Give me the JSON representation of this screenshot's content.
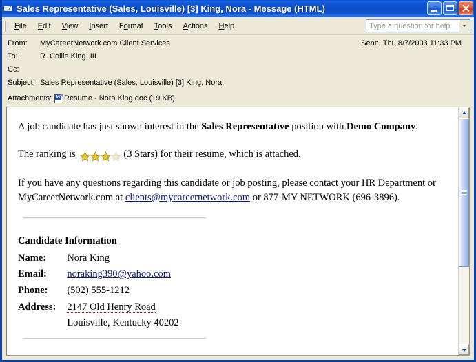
{
  "window": {
    "title": "Sales Representative (Sales, Louisville) [3] King, Nora - Message (HTML)",
    "title_icon": "envelope-icon",
    "minimize_label": "Minimize",
    "maximize_label": "Maximize",
    "close_label": "Close",
    "accent_titlebar": "#0c4ec9",
    "border_color": "#0a3fa8",
    "chrome_background": "#ece9d8"
  },
  "menu": {
    "items": [
      {
        "label": "File",
        "accel": "F"
      },
      {
        "label": "Edit",
        "accel": "E"
      },
      {
        "label": "View",
        "accel": "V"
      },
      {
        "label": "Insert",
        "accel": "I"
      },
      {
        "label": "Format",
        "accel": "o"
      },
      {
        "label": "Tools",
        "accel": "T"
      },
      {
        "label": "Actions",
        "accel": "A"
      },
      {
        "label": "Help",
        "accel": "H"
      }
    ],
    "help_placeholder": "Type a question for help"
  },
  "header": {
    "from_label": "From:",
    "from_value": "MyCareerNetwork.com Client Services",
    "to_label": "To:",
    "to_value": "R. Collie King, III",
    "cc_label": "Cc:",
    "cc_value": "",
    "subject_label": "Subject:",
    "subject_value": "Sales Representative (Sales, Louisville) [3] King, Nora",
    "sent_label": "Sent:",
    "sent_value": "Thu 8/7/2003 11:33 PM",
    "attachments_label": "Attachments:",
    "attachment_name": "Resume - Nora King.doc (19 KB)",
    "attachment_icon": "word-document-icon"
  },
  "body": {
    "p1_a": "A job candidate has just shown interest in the ",
    "p1_bold1": "Sales Representative",
    "p1_b": " position with ",
    "p1_bold2": "Demo Company",
    "p1_c": ".",
    "p2_a": "The ranking is ",
    "p2_b": "(3 Stars) for their resume, which is attached.",
    "stars_filled": 3,
    "stars_total": 4,
    "star_fill_color": "#e8c830",
    "star_empty_color": "#f2efd6",
    "p3_a": "If you have any questions regarding this candidate or job posting, please contact your HR Department or MyCareerNetwork.com at ",
    "p3_link": "clients@mycareernetwork.com",
    "p3_b": " or 877-MY NETWORK (696-3896)."
  },
  "candidate": {
    "heading": "Candidate Information",
    "rows": [
      {
        "key": "Name:",
        "value": "Nora King",
        "kind": "text"
      },
      {
        "key": "Email:",
        "value": "noraking390@yahoo.com",
        "kind": "link"
      },
      {
        "key": "Phone:",
        "value": "(502) 555-1212",
        "kind": "text"
      },
      {
        "key": "Address:",
        "value": "2147 Old Henry Road",
        "kind": "smarttag"
      },
      {
        "key": "",
        "value": "Louisville, Kentucky 40202",
        "kind": "text"
      }
    ],
    "link_color": "#111a6e",
    "smarttag_color": "#cc0000"
  },
  "scrollbar": {
    "up_icon": "chevron-up-icon",
    "down_icon": "chevron-down-icon"
  }
}
